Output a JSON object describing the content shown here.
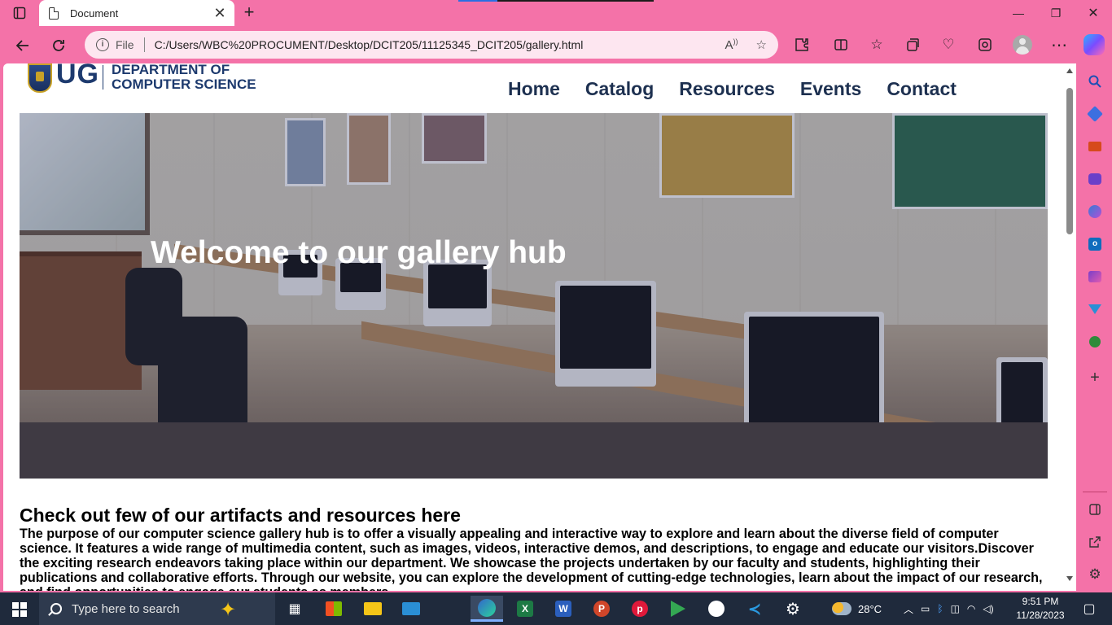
{
  "browser": {
    "tab_title": "Document",
    "tab_close": "✕",
    "new_tab": "+",
    "file_label": "File",
    "url": "C:/Users/WBC%20PROCUMENT/Desktop/DCIT205/11125345_DCIT205/gallery.html",
    "window_controls": {
      "minimize": "—",
      "restore": "❐",
      "close": "✕"
    }
  },
  "site": {
    "logo_letters": "UG",
    "logo_dept_line1": "DEPARTMENT OF",
    "logo_dept_line2": "COMPUTER SCIENCE",
    "nav": [
      "Home",
      "Catalog",
      "Resources",
      "Events",
      "Contact"
    ],
    "hero_title": "Welcome to our gallery hub",
    "section_heading": "Check out few of our artifacts and resources here",
    "section_body": "The purpose of our computer science gallery hub is to offer a visually appealing and interactive way to explore and learn about the diverse field of computer science. It features a wide range of multimedia content, such as images, videos, interactive demos, and descriptions, to engage and educate our visitors.Discover the exciting research endeavors taking place within our department. We showcase the projects undertaken by our faculty and students, highlighting their publications and collaborative efforts. Through our website, you can explore the development of cutting-edge technologies, learn about the impact of our research, and find opportunities to engage our students as members"
  },
  "taskbar": {
    "search_placeholder": "Type here to search",
    "weather": "28°C",
    "time": "9:51 PM",
    "date": "11/28/2023"
  },
  "colors": {
    "browser_frame": "#f472a8",
    "brand_navy": "#1d3a6e",
    "taskbar": "#1f2a3c"
  }
}
